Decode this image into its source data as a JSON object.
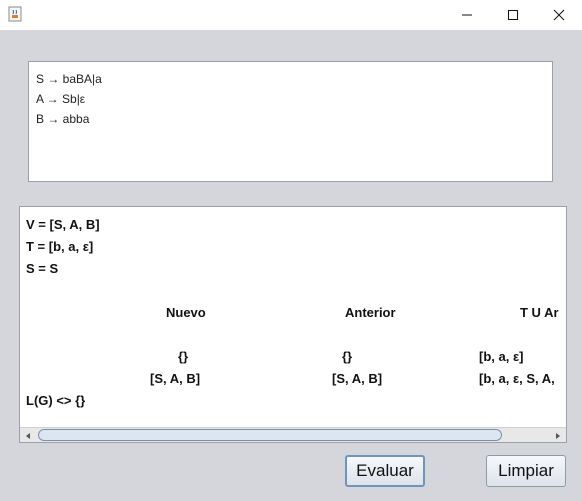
{
  "window": {
    "icon": "java-cup-icon",
    "controls": [
      "minimize-icon",
      "maximize-icon",
      "close-icon"
    ]
  },
  "grammar": {
    "lines": [
      "S → baBA|a",
      "A → Sb|ε",
      "B → abba"
    ]
  },
  "result": {
    "v_line": "V = [S, A, B]",
    "t_line": "T = [b, a, ε]",
    "s_line": "S = S",
    "headers": {
      "nuevo": "Nuevo",
      "anterior": "Anterior",
      "tua": "T U Ar"
    },
    "rows": [
      {
        "nuevo": "{}",
        "anterior": "{}",
        "tua": "[b, a, ε]"
      },
      {
        "nuevo": "[S, A, B]",
        "anterior": "[S, A, B]",
        "tua": "[b, a, ε, S, A,"
      }
    ],
    "conclusion": "L(G) <> {}"
  },
  "buttons": {
    "evaluate": "Evaluar",
    "clear": "Limpiar"
  }
}
